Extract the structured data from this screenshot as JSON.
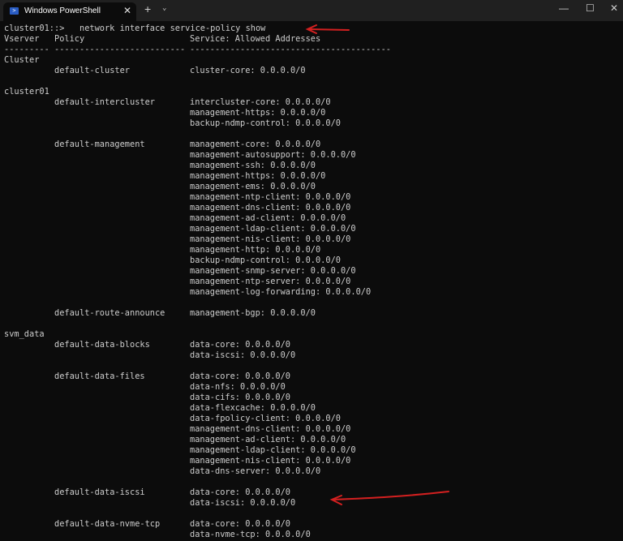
{
  "window": {
    "tab_title": "Windows PowerShell",
    "tab_close": "✕",
    "new_tab": "+",
    "dropdown": "⌄",
    "minimize": "—",
    "maximize": "☐",
    "close": "✕"
  },
  "terminal": {
    "lines": [
      {
        "c1": "cluster01::>   network interface service-policy show"
      },
      {
        "c1": "Vserver",
        "c2": "Policy",
        "c3": "Service: Allowed Addresses"
      },
      {
        "c1": "---------",
        "c2": "--------------------------",
        "c3": "----------------------------------------"
      },
      {
        "c1": "Cluster"
      },
      {
        "c2": "default-cluster",
        "c3": "cluster-core: 0.0.0.0/0"
      },
      {},
      {
        "c1": "cluster01"
      },
      {
        "c2": "default-intercluster",
        "c3": "intercluster-core: 0.0.0.0/0"
      },
      {
        "c3": "management-https: 0.0.0.0/0"
      },
      {
        "c3": "backup-ndmp-control: 0.0.0.0/0"
      },
      {},
      {
        "c2": "default-management",
        "c3": "management-core: 0.0.0.0/0"
      },
      {
        "c3": "management-autosupport: 0.0.0.0/0"
      },
      {
        "c3": "management-ssh: 0.0.0.0/0"
      },
      {
        "c3": "management-https: 0.0.0.0/0"
      },
      {
        "c3": "management-ems: 0.0.0.0/0"
      },
      {
        "c3": "management-ntp-client: 0.0.0.0/0"
      },
      {
        "c3": "management-dns-client: 0.0.0.0/0"
      },
      {
        "c3": "management-ad-client: 0.0.0.0/0"
      },
      {
        "c3": "management-ldap-client: 0.0.0.0/0"
      },
      {
        "c3": "management-nis-client: 0.0.0.0/0"
      },
      {
        "c3": "management-http: 0.0.0.0/0"
      },
      {
        "c3": "backup-ndmp-control: 0.0.0.0/0"
      },
      {
        "c3": "management-snmp-server: 0.0.0.0/0"
      },
      {
        "c3": "management-ntp-server: 0.0.0.0/0"
      },
      {
        "c3": "management-log-forwarding: 0.0.0.0/0"
      },
      {},
      {
        "c2": "default-route-announce",
        "c3": "management-bgp: 0.0.0.0/0"
      },
      {},
      {
        "c1": "svm_data"
      },
      {
        "c2": "default-data-blocks",
        "c3": "data-core: 0.0.0.0/0"
      },
      {
        "c3": "data-iscsi: 0.0.0.0/0"
      },
      {},
      {
        "c2": "default-data-files",
        "c3": "data-core: 0.0.0.0/0"
      },
      {
        "c3": "data-nfs: 0.0.0.0/0"
      },
      {
        "c3": "data-cifs: 0.0.0.0/0"
      },
      {
        "c3": "data-flexcache: 0.0.0.0/0"
      },
      {
        "c3": "data-fpolicy-client: 0.0.0.0/0"
      },
      {
        "c3": "management-dns-client: 0.0.0.0/0"
      },
      {
        "c3": "management-ad-client: 0.0.0.0/0"
      },
      {
        "c3": "management-ldap-client: 0.0.0.0/0"
      },
      {
        "c3": "management-nis-client: 0.0.0.0/0"
      },
      {
        "c3": "data-dns-server: 0.0.0.0/0"
      },
      {},
      {
        "c2": "default-data-iscsi",
        "c3": "data-core: 0.0.0.0/0"
      },
      {
        "c3": "data-iscsi: 0.0.0.0/0"
      },
      {},
      {
        "c2": "default-data-nvme-tcp",
        "c3": "data-core: 0.0.0.0/0"
      },
      {
        "c3": "data-nvme-tcp: 0.0.0.0/0"
      }
    ]
  },
  "colors": {
    "annotation": "#d42020",
    "text": "#cccccc",
    "background": "#0c0c0c"
  }
}
